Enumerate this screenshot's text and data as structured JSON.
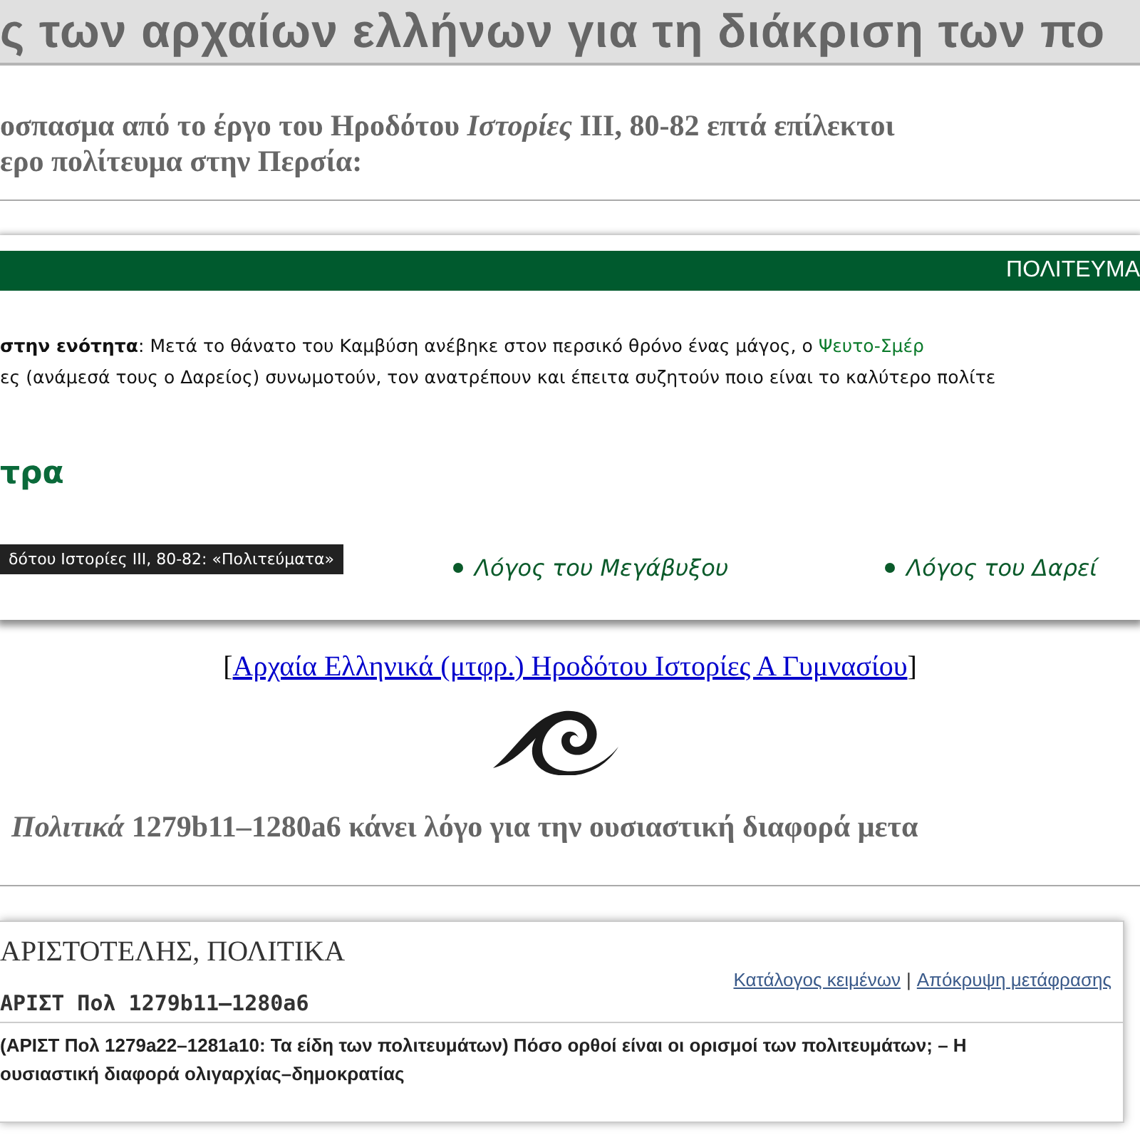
{
  "page_title": "ς των αρχαίων ελλήνων για τη διάκριση των πο",
  "intro": {
    "lines": [
      "οσπασμα από το έργο του Ηροδότου *Ιστορίες* ΙΙΙ, 80-82 επτά επίλεκτοι",
      "ερο πολίτευμα στην Περσία:"
    ]
  },
  "embedded_page": {
    "banner": "ΠΟΛΙΤΕΥΜΑ",
    "summary_label": "στην ενότητα",
    "summary_separator": ":",
    "summary_lines": [
      "Μετά το θάνατο του Καμβύση ανέβηκε στον περσικό θρόνο ένας μάγος, ο",
      "ες (ανάμεσά τους ο Δαρείος) συνωμοτούν, τον ανατρέπουν και έπειτα συζητούν ποιο είναι το καλύτερο πολίτε"
    ],
    "summary_link": "Ψευτο-Σμέρ",
    "heading": "τρα",
    "tooltip": "δότου Ιστορίες ΙΙΙ, 80-82: «Πολιτεύματα»",
    "speeches": [
      "Λόγος του Μεγάβυξου",
      "Λόγος του Δαρεί"
    ]
  },
  "source_link": {
    "open": "[",
    "label": "Αρχαία Ελληνικά (μτφρ.) Ηροδότου Ιστορίες Α Γυμνασίου",
    "close": "]"
  },
  "second_paragraph": "*Πολιτικά* 1279b11–1280a6 κάνει λόγο για την ουσιαστική διαφορά μετα",
  "text_panel": {
    "title": "ΑΡΙΣΤΟΤΕΛΗΣ, ΠΟΛΙΤΙΚΑ",
    "reference": "ΑΡΙΣΤ Πολ 1279b11–1280a6",
    "links": [
      "Κατάλογος κειμένων",
      "Απόκρυψη μετάφρασης"
    ],
    "link_separator": "|",
    "section_title": "(ΑΡΙΣΤ Πολ 1279a22–1281a10: Τα είδη των πολιτευμάτων) Πόσο ορθοί είναι οι ορισμοί των πολιτευμάτων; – Η ουσιαστική διαφορά ολιγαρχίας–δημοκρατίας"
  }
}
